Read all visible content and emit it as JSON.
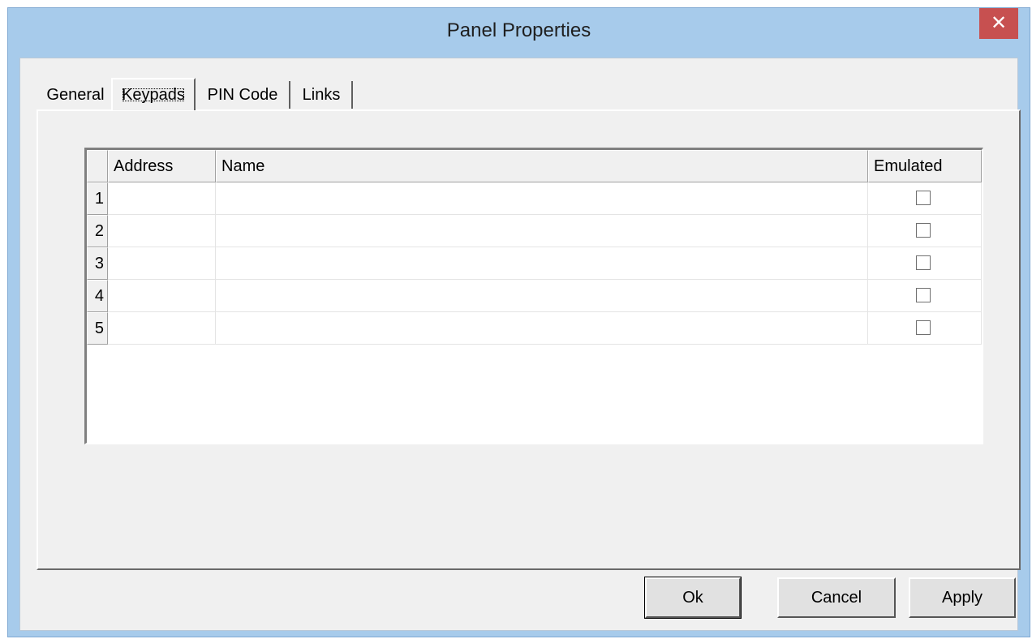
{
  "window": {
    "title": "Panel Properties",
    "close_symbol": "✕"
  },
  "tabs": [
    {
      "label": "General",
      "active": false
    },
    {
      "label": "Keypads",
      "active": true
    },
    {
      "label": "PIN Code",
      "active": false
    },
    {
      "label": "Links",
      "active": false
    }
  ],
  "grid": {
    "columns": [
      "Address",
      "Name",
      "Emulated"
    ],
    "rows": [
      {
        "num": "1",
        "address": "",
        "name": "",
        "emulated": false
      },
      {
        "num": "2",
        "address": "",
        "name": "",
        "emulated": false
      },
      {
        "num": "3",
        "address": "",
        "name": "",
        "emulated": false
      },
      {
        "num": "4",
        "address": "",
        "name": "",
        "emulated": false
      },
      {
        "num": "5",
        "address": "",
        "name": "",
        "emulated": false
      }
    ]
  },
  "buttons": {
    "ok": "Ok",
    "cancel": "Cancel",
    "apply": "Apply"
  },
  "colors": {
    "titlebar": "#a7cbeb",
    "close": "#c75050",
    "face": "#f0f0f0"
  }
}
